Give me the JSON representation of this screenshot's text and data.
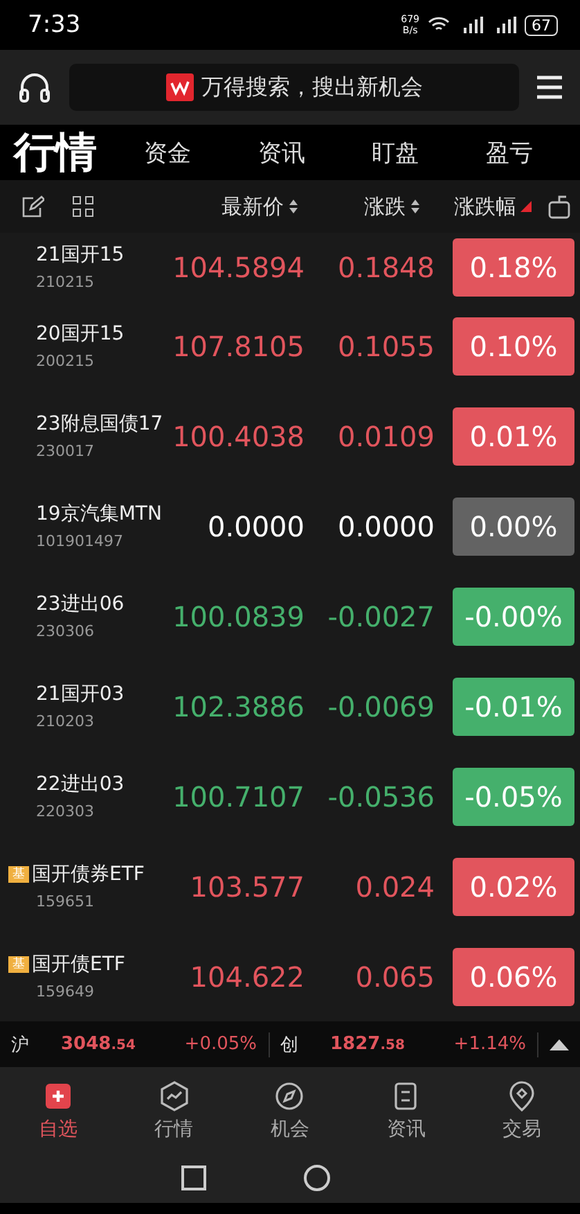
{
  "status_bar": {
    "time": "7:33",
    "speed": "679",
    "speed_unit": "B/s",
    "battery": "67"
  },
  "search": {
    "placeholder": "万得搜索，搜出新机会"
  },
  "tabs": [
    {
      "label": "行情",
      "selected": true
    },
    {
      "label": "资金",
      "selected": false
    },
    {
      "label": "资讯",
      "selected": false
    },
    {
      "label": "盯盘",
      "selected": false
    },
    {
      "label": "盈亏",
      "selected": false
    }
  ],
  "columns": [
    {
      "label": "最新价",
      "sorted": false
    },
    {
      "label": "涨跌",
      "sorted": false
    },
    {
      "label": "涨跌幅",
      "sorted": true
    }
  ],
  "rows": [
    {
      "name": "21国开15",
      "code": "210215",
      "price": "104.5894",
      "change": "0.1848",
      "pct": "0.18%",
      "kind": "up"
    },
    {
      "name": "20国开15",
      "code": "200215",
      "price": "107.8105",
      "change": "0.1055",
      "pct": "0.10%",
      "kind": "up"
    },
    {
      "name": "23附息国债17",
      "code": "230017",
      "price": "100.4038",
      "change": "0.0109",
      "pct": "0.01%",
      "kind": "up"
    },
    {
      "name": "19京汽集MTN",
      "code": "101901497",
      "price": "0.0000",
      "change": "0.0000",
      "pct": "0.00%",
      "kind": "flat"
    },
    {
      "name": "23进出06",
      "code": "230306",
      "price": "100.0839",
      "change": "-0.0027",
      "pct": "-0.00%",
      "kind": "down"
    },
    {
      "name": "21国开03",
      "code": "210203",
      "price": "102.3886",
      "change": "-0.0069",
      "pct": "-0.01%",
      "kind": "down"
    },
    {
      "name": "22进出03",
      "code": "220303",
      "price": "100.7107",
      "change": "-0.0536",
      "pct": "-0.05%",
      "kind": "down"
    },
    {
      "name": "国开债券ETF",
      "code": "159651",
      "price": "103.577",
      "change": "0.024",
      "pct": "0.02%",
      "kind": "up",
      "badge": "基"
    },
    {
      "name": "国开债ETF",
      "code": "159649",
      "price": "104.622",
      "change": "0.065",
      "pct": "0.06%",
      "kind": "up",
      "badge": "基"
    }
  ],
  "indices": [
    {
      "label": "沪",
      "int": "3048",
      "dec": ".54",
      "pct": "+0.05%"
    },
    {
      "label": "创",
      "int": "1827",
      "dec": ".58",
      "pct": "+1.14%"
    }
  ],
  "nav": [
    {
      "label": "自选",
      "selected": true
    },
    {
      "label": "行情",
      "selected": false
    },
    {
      "label": "机会",
      "selected": false
    },
    {
      "label": "资讯",
      "selected": false
    },
    {
      "label": "交易",
      "selected": false
    }
  ]
}
